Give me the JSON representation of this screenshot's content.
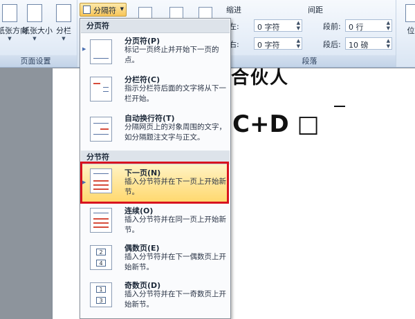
{
  "ribbon": {
    "page_setup": {
      "orientation_label": "纸张方向",
      "size_label": "纸张大小",
      "columns_label": "分栏",
      "group_label": "页面设置"
    },
    "breaks_button_label": "分隔符",
    "paragraph": {
      "indent_title": "缩进",
      "spacing_title": "间距",
      "left_label": "左:",
      "left_value": "0 字符",
      "right_label": "右:",
      "right_value": "0 字符",
      "before_label": "段前:",
      "before_value": "0 行",
      "after_label": "段后:",
      "after_value": "10 磅",
      "group_label": "段落"
    },
    "position_label": "位"
  },
  "document": {
    "line1": "合伙人",
    "line2": "C+D □"
  },
  "menu": {
    "section_page_breaks": "分页符",
    "section_section_breaks": "分节符",
    "items": [
      {
        "title": "分页符(P)",
        "desc": "标记一页终止并开始下一页的点。"
      },
      {
        "title": "分栏符(C)",
        "desc": "指示分栏符后面的文字将从下一栏开始。"
      },
      {
        "title": "自动换行符(T)",
        "desc": "分隔网页上的对象周围的文字，如分隔题注文字与正文。"
      },
      {
        "title": "下一页(N)",
        "desc": "插入分节符并在下一页上开始新节。"
      },
      {
        "title": "连续(O)",
        "desc": "插入分节符并在同一页上开始新节。"
      },
      {
        "title": "偶数页(E)",
        "desc": "插入分节符并在下一偶数页上开始新节。"
      },
      {
        "title": "奇数页(D)",
        "desc": "插入分节符并在下一奇数页上开始新节。"
      }
    ]
  },
  "colors": {
    "highlight": "#d8131f",
    "selected_bg": "#ffd86e",
    "ribbon_bg": "#e6eef8"
  }
}
